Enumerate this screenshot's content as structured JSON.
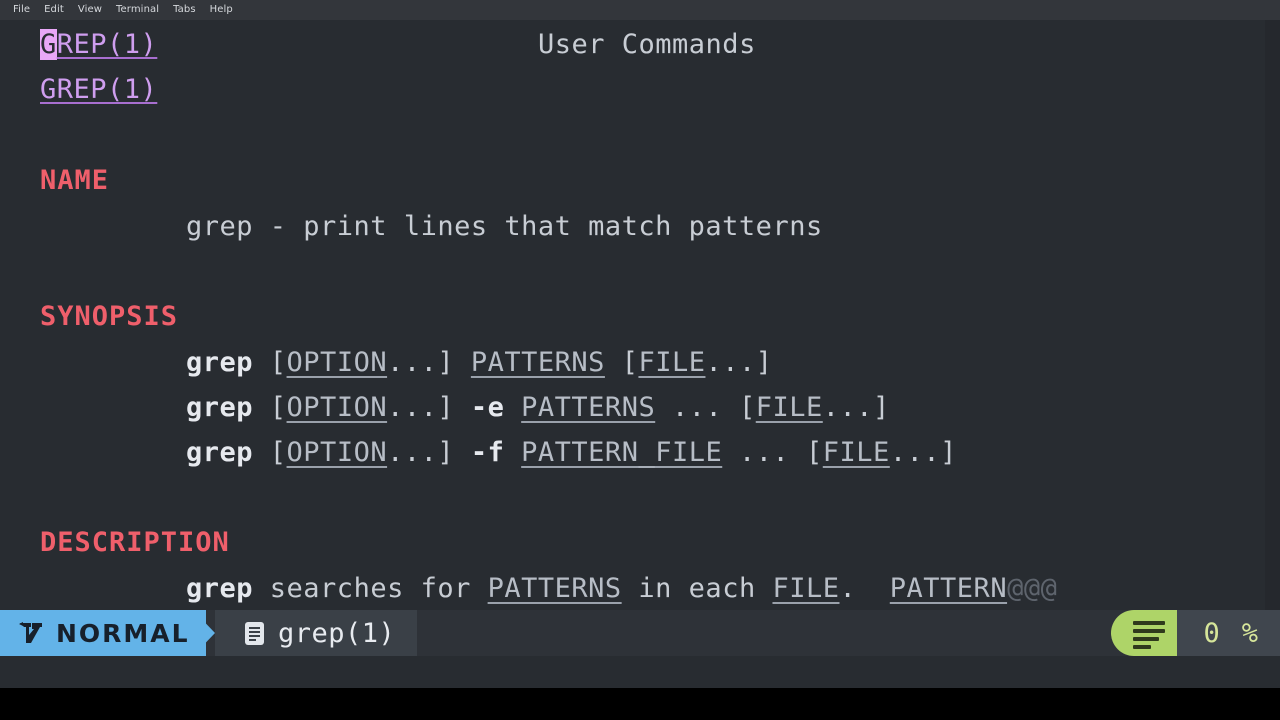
{
  "window": {
    "menubar": [
      {
        "label": "File"
      },
      {
        "label": "Edit"
      },
      {
        "label": "View"
      },
      {
        "label": "Terminal"
      },
      {
        "label": "Tabs"
      },
      {
        "label": "Help"
      }
    ]
  },
  "colors": {
    "background": "#282c31",
    "foreground": "#c8cdd4",
    "header_red": "#ef5f6b",
    "title_purple": "#cf9eef",
    "cursor": "#e9a8f7",
    "mode_blue": "#63b3e8",
    "percent_green": "#aed468"
  },
  "manpage": {
    "header_left_cursor_char": "G",
    "header_left_rest": "REP(1)",
    "header_center": "User Commands",
    "header_right": "GREP(1)",
    "sections": [
      {
        "name": "NAME",
        "body": "grep - print lines that match patterns"
      },
      {
        "name": "SYNOPSIS",
        "usage": [
          {
            "cmd": "grep",
            "open": " [",
            "option": "OPTION",
            "dots1": "...] ",
            "flag": "",
            "arg": "PATTERNS",
            "mid": " [",
            "file": "FILE",
            "close": "...]"
          },
          {
            "cmd": "grep",
            "open": " [",
            "option": "OPTION",
            "dots1": "...] ",
            "flag": "-e ",
            "arg": "PATTERNS",
            "mid": " ... [",
            "file": "FILE",
            "close": "...]"
          },
          {
            "cmd": "grep",
            "open": " [",
            "option": "OPTION",
            "dots1": "...] ",
            "flag": "-f ",
            "arg": "PATTERN_FILE",
            "mid": " ... [",
            "file": "FILE",
            "close": "...]"
          }
        ]
      },
      {
        "name": "DESCRIPTION",
        "line": {
          "cmd": "grep",
          "t1": " searches for ",
          "u1": "PATTERNS",
          "t2": " in each ",
          "u2": "FILE",
          "t3": ".  ",
          "u3": "PATTERN",
          "overflow": "@@@"
        }
      }
    ]
  },
  "statusline": {
    "mode": "NORMAL",
    "vim_icon": "vim-logo-icon",
    "file_icon": "document-icon",
    "filename": "grep(1)",
    "lines_icon": "align-lines-icon",
    "position_value": "0",
    "position_unit": "%"
  }
}
